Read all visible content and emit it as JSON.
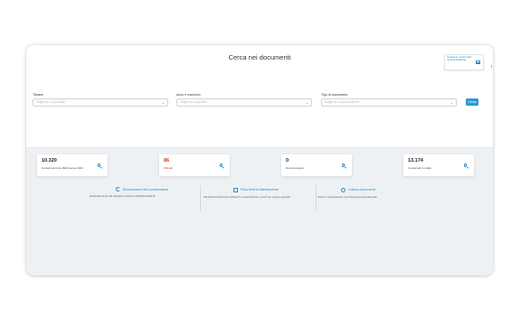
{
  "page": {
    "title": "Cerca nei documenti"
  },
  "help": {
    "text": "Guarda le novità della nuova interfaccia"
  },
  "filters": [
    {
      "label": "Titolare",
      "placeholder": "Scegli uno o più titolari"
    },
    {
      "label": "Anno e esercizio",
      "placeholder": "Scegli uno o più anni"
    },
    {
      "label": "Tipo di documento",
      "placeholder": "Scegli uno o più documenti"
    }
  ],
  "search_button": {
    "label": "Cerca"
  },
  "stats": [
    {
      "value": "10.320",
      "caption": "Conservati Anno Riferimento 2024",
      "accent": false
    },
    {
      "value": "86",
      "caption": "Rifiutati",
      "accent": true
    },
    {
      "value": "0",
      "caption": "Da processare",
      "accent": false
    },
    {
      "value": "13.174",
      "caption": "Conservati in totale",
      "accent": false
    }
  ],
  "features": [
    {
      "icon": "refresh-icon",
      "title": "Dichiarazioni del conservatore",
      "description": "Dichiarazioni per SIL deleteria conforma dell’ErPA 2022/72"
    },
    {
      "icon": "folder-icon",
      "title": "Pacchetti di distribuzione",
      "description": "Pacchetti di documenti richiesti in conservazione e pronti per essere esportati"
    },
    {
      "icon": "cloud-icon",
      "title": "Carica documenti",
      "description": "Invia in conservazione i tuoi documenti manualmente"
    }
  ],
  "colors": {
    "accent": "#2a9ad6",
    "link": "#2a8ac6",
    "alert": "#d9342b",
    "panel_bg": "#eef1f4"
  }
}
